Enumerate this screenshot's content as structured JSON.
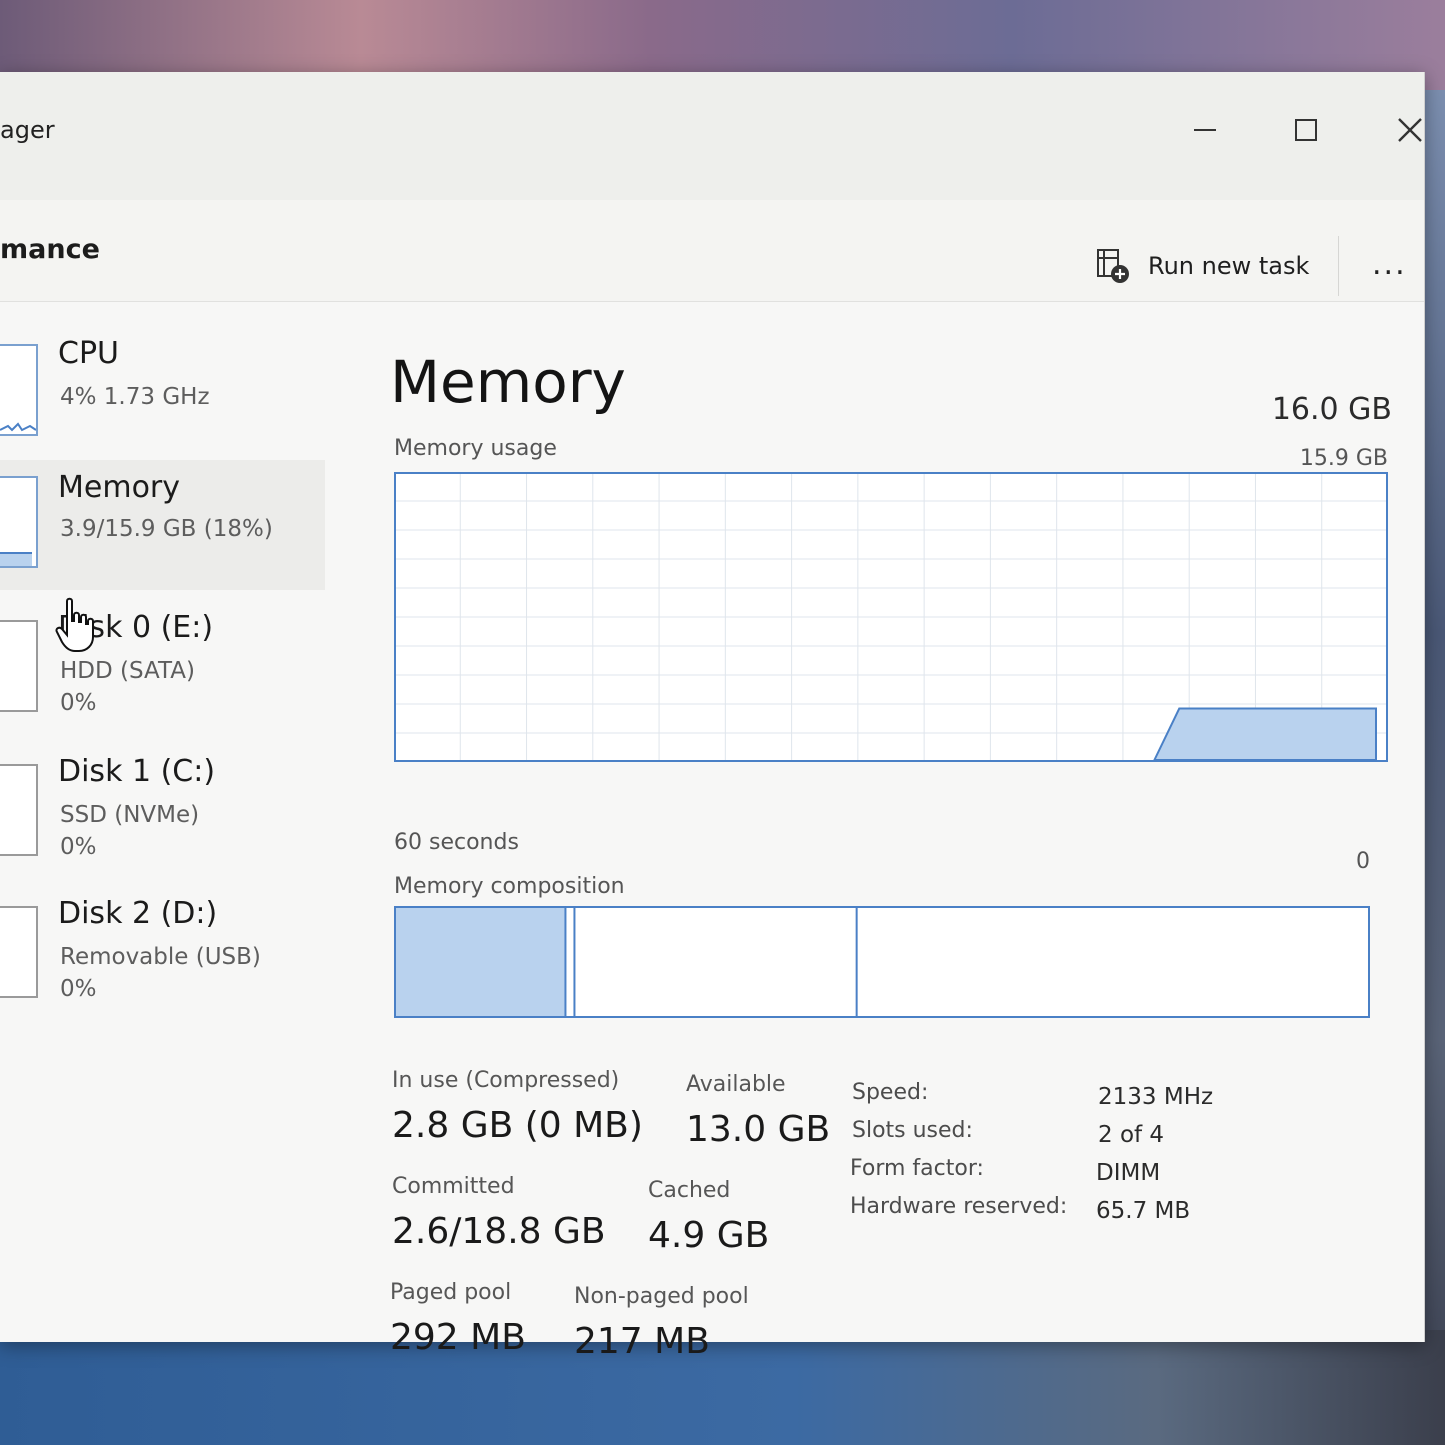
{
  "window": {
    "title_fragment": "ager",
    "section_fragment": "mance"
  },
  "toolbar": {
    "run_new_task_label": "Run new task",
    "more_label": "..."
  },
  "sidebar": {
    "items": [
      {
        "name": "CPU",
        "sub": "4%  1.73 GHz",
        "sub2": ""
      },
      {
        "name": "Memory",
        "sub": "3.9/15.9 GB (18%)",
        "sub2": ""
      },
      {
        "name": "Disk 0 (E:)",
        "sub": "HDD (SATA)",
        "sub2": "0%"
      },
      {
        "name": "Disk 1 (C:)",
        "sub": "SSD (NVMe)",
        "sub2": "0%"
      },
      {
        "name": "Disk 2 (D:)",
        "sub": "Removable (USB)",
        "sub2": "0%"
      }
    ]
  },
  "main": {
    "title": "Memory",
    "total": "16.0 GB",
    "usage_label": "Memory usage",
    "usage_max": "15.9 GB",
    "time_span": "60 seconds",
    "zero": "0",
    "composition_label": "Memory composition",
    "usage_level": 0.18,
    "composition": {
      "in_use_fraction": 0.175,
      "standby_end_fraction": 0.475
    },
    "stats": {
      "in_use_label": "In use (Compressed)",
      "in_use_value": "2.8 GB (0 MB)",
      "available_label": "Available",
      "available_value": "13.0 GB",
      "committed_label": "Committed",
      "committed_value": "2.6/18.8 GB",
      "cached_label": "Cached",
      "cached_value": "4.9 GB",
      "paged_label": "Paged pool",
      "paged_value": "292 MB",
      "nonpaged_label": "Non-paged pool",
      "nonpaged_value": "217 MB"
    },
    "specs": {
      "speed_label": "Speed:",
      "speed_value": "2133 MHz",
      "slots_label": "Slots used:",
      "slots_value": "2 of 4",
      "form_label": "Form factor:",
      "form_value": "DIMM",
      "hw_label": "Hardware reserved:",
      "hw_value": "65.7 MB"
    }
  },
  "colors": {
    "accent": "#4a80c6",
    "fill": "#b9d2ee",
    "grid": "#dfe5ec"
  },
  "icons": {
    "minimize": "minimize-icon",
    "maximize": "maximize-icon",
    "close": "close-icon",
    "run_task": "run-task-icon",
    "cursor": "hand-cursor-icon"
  }
}
